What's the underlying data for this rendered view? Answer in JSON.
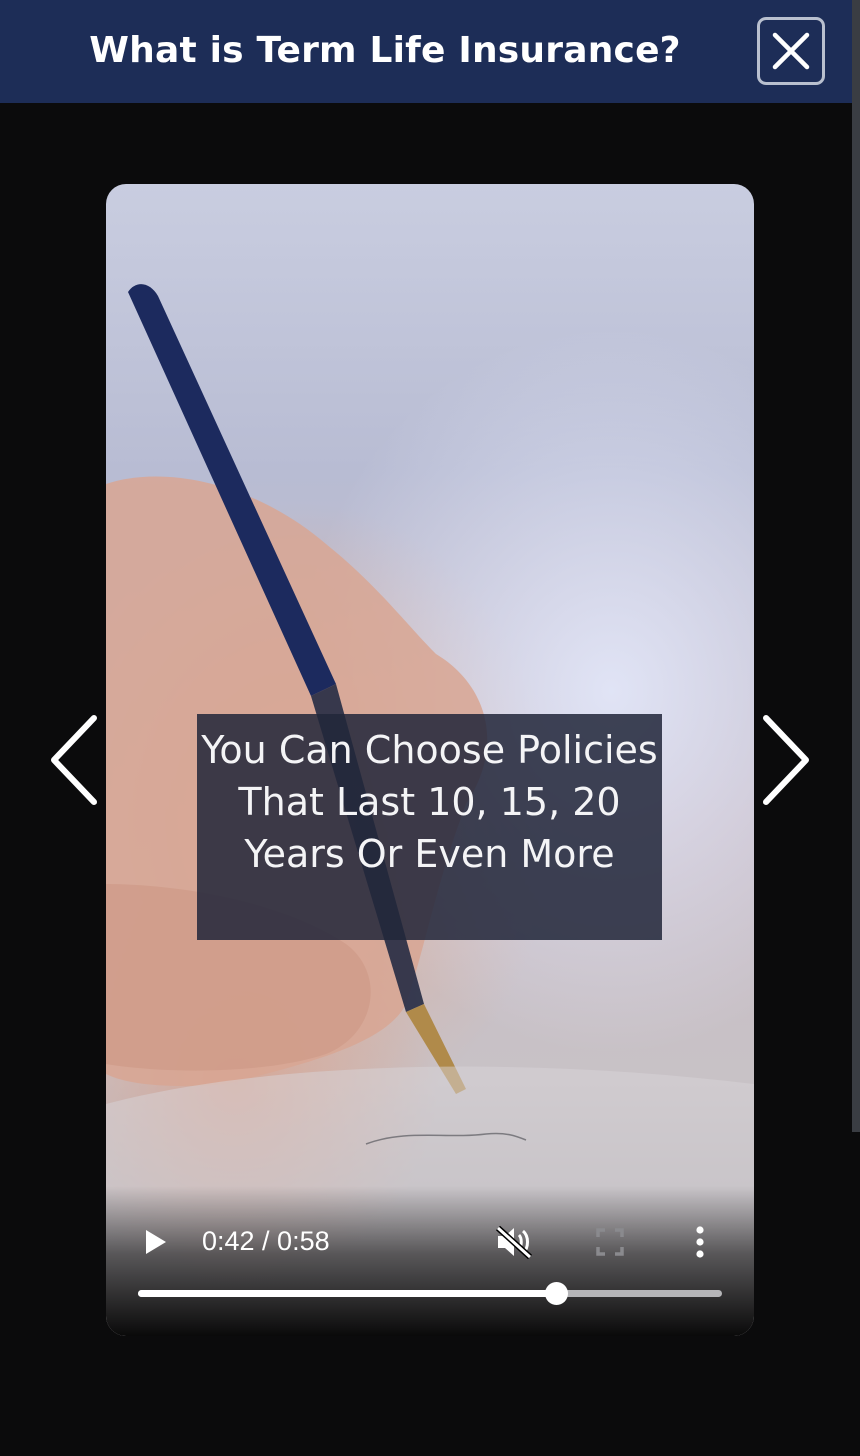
{
  "header": {
    "title": "What is Term Life Insurance?",
    "close_icon": "close-icon",
    "background": "#1d2d57"
  },
  "video": {
    "caption": "You Can Choose Policies That Last 10, 15, 20 Years Or Even More",
    "controls": {
      "time_display": "0:42 / 0:58",
      "current": "0:42",
      "duration": "0:58",
      "progress_fraction": 0.7161,
      "muted": true,
      "icons": [
        "play-icon",
        "volume-muted-icon",
        "fullscreen-icon",
        "more-vert-icon"
      ]
    }
  },
  "navigation": {
    "prev_icon": "chevron-left-icon",
    "next_icon": "chevron-right-icon"
  }
}
